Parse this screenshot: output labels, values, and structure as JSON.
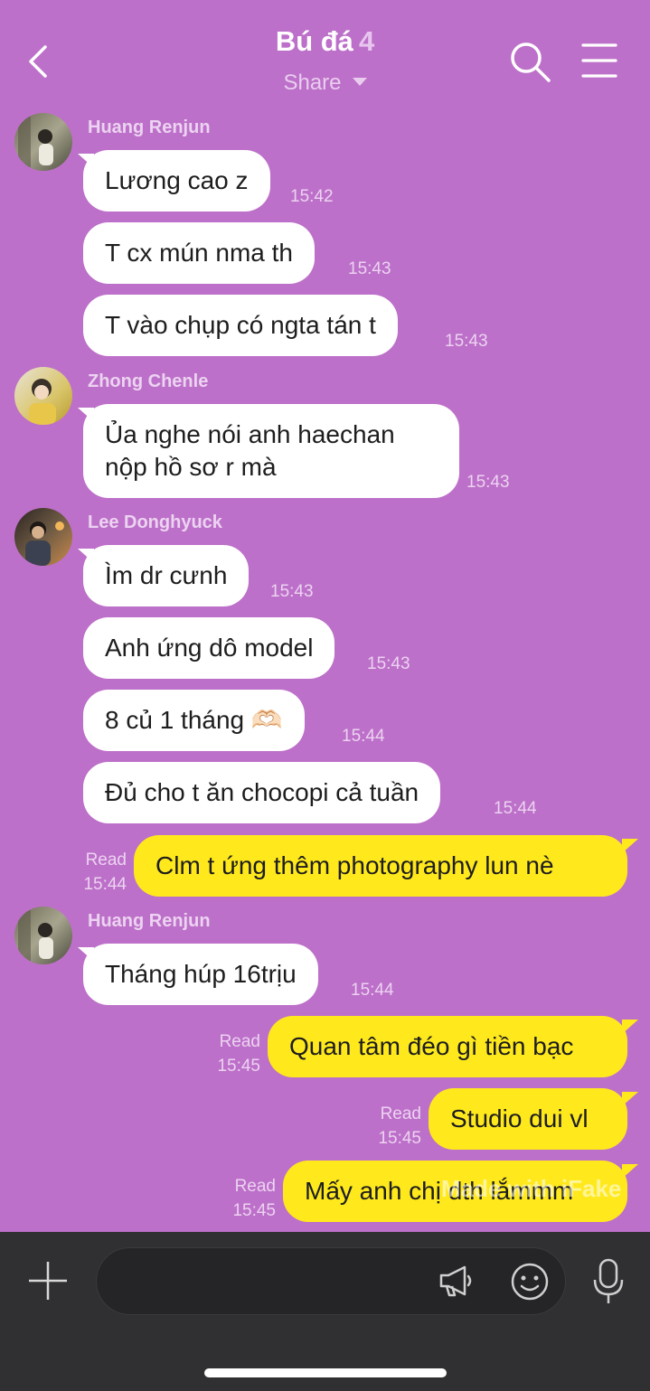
{
  "header": {
    "title": "Bú đá",
    "member_count": "4",
    "share_label": "Share"
  },
  "messages": [
    {
      "sender": "Huang Renjun",
      "text": "Lương cao z",
      "time": "15:42"
    },
    {
      "text": "T cx mún nma th",
      "time": "15:43"
    },
    {
      "text": "T vào chụp có ngta tán t",
      "time": "15:43"
    },
    {
      "sender": "Zhong Chenle",
      "text": "Ủa nghe nói anh haechan nộp hồ sơ r mà",
      "time": "15:43"
    },
    {
      "sender": "Lee Donghyuck",
      "text": "Ìm dr cưnh",
      "time": "15:43"
    },
    {
      "text": "Anh ứng dô model",
      "time": "15:43"
    },
    {
      "text": "8 củ 1 tháng 🫶🏻",
      "time": "15:44"
    },
    {
      "text": "Đủ cho t ăn chocopi cả tuần",
      "time": "15:44"
    },
    {
      "outgoing": true,
      "read": "Read",
      "text": "Clm t ứng thêm photography lun nè",
      "time": "15:44"
    },
    {
      "sender": "Huang Renjun",
      "text": "Tháng húp 16trịu",
      "time": "15:44"
    },
    {
      "outgoing": true,
      "read": "Read",
      "text": "Quan tâm đéo gì tiền bạc",
      "time": "15:45"
    },
    {
      "outgoing": true,
      "read": "Read",
      "text": "Studio dui vl",
      "time": "15:45"
    },
    {
      "outgoing": true,
      "read": "Read",
      "text": "Mấy anh chị dth lắmmm",
      "time": "15:45"
    }
  ],
  "watermark": "Made with iFake",
  "icons": {
    "back": "back-chevron-icon",
    "search": "search-icon",
    "menu": "hamburger-menu-icon",
    "plus": "plus-icon",
    "megaphone": "megaphone-icon",
    "emoji": "emoji-icon",
    "mic": "microphone-icon"
  },
  "colors": {
    "background": "#bd70c9",
    "incoming_bubble": "#ffffff",
    "outgoing_bubble": "#ffe91d",
    "composer": "#303033"
  }
}
